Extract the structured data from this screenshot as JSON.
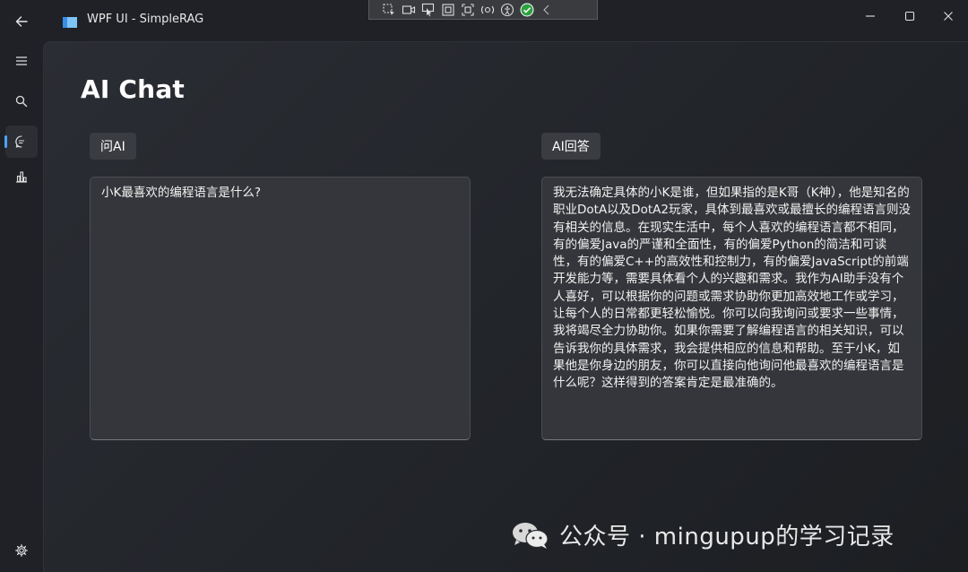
{
  "window": {
    "title": "WPF UI - SimpleRAG",
    "controls": [
      "minimize",
      "maximize",
      "close"
    ]
  },
  "debug_toolbar": {
    "icons": [
      "select-element-icon",
      "record-icon",
      "pointer-icon",
      "frame-icon",
      "adorner-icon",
      "hot-reload-icon",
      "accessibility-icon",
      "check-icon",
      "collapse-icon"
    ]
  },
  "sidebar": {
    "items": [
      {
        "name": "menu",
        "icon": "hamburger-icon",
        "active": false
      },
      {
        "name": "search",
        "icon": "search-icon",
        "active": false
      },
      {
        "name": "chat",
        "icon": "chat-icon",
        "active": true
      },
      {
        "name": "stats",
        "icon": "bar-chart-icon",
        "active": false
      }
    ],
    "footer": {
      "name": "settings",
      "icon": "gear-icon"
    }
  },
  "page": {
    "title": "AI Chat",
    "question_label": "问AI",
    "answer_label": "AI回答",
    "question_text": "小K最喜欢的编程语言是什么?",
    "answer_text": "我无法确定具体的小K是谁，但如果指的是K哥（K神），他是知名的职业DotA以及DotA2玩家，具体到最喜欢或最擅长的编程语言则没有相关的信息。在现实生活中，每个人喜欢的编程语言都不相同，有的偏爱Java的严谨和全面性，有的偏爱Python的简洁和可读性，有的偏爱C++的高效性和控制力，有的偏爱JavaScript的前端开发能力等，需要具体看个人的兴趣和需求。我作为AI助手没有个人喜好，可以根据你的问题或需求协助你更加高效地工作或学习，让每个人的日常都更轻松愉悦。你可以向我询问或要求一些事情，我将竭尽全力协助你。如果你需要了解编程语言的相关知识，可以告诉我你的具体需求，我会提供相应的信息和帮助。至于小K，如果他是你身边的朋友，你可以直接向他询问他最喜欢的编程语言是什么呢？这样得到的答案肯定是最准确的。"
  },
  "watermark": {
    "text": "公众号 · mingupup的学习记录",
    "icon": "wechat-icon"
  },
  "colors": {
    "accent": "#4ea3ff",
    "background": "#1f2126",
    "panel": "#34363b"
  }
}
